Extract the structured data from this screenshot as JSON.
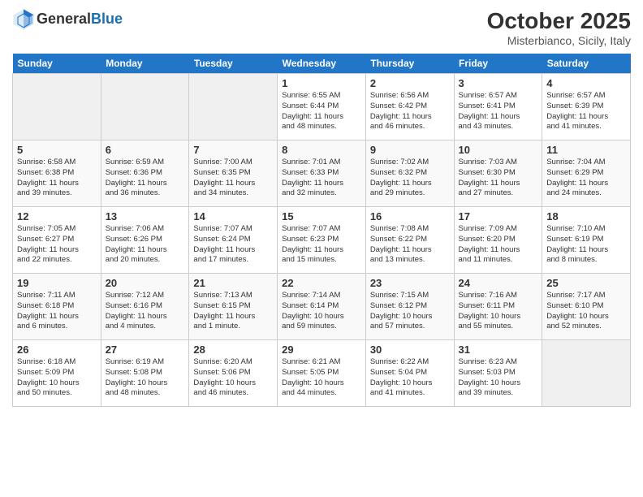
{
  "header": {
    "logo_general": "General",
    "logo_blue": "Blue",
    "month_title": "October 2025",
    "location": "Misterbianco, Sicily, Italy"
  },
  "weekdays": [
    "Sunday",
    "Monday",
    "Tuesday",
    "Wednesday",
    "Thursday",
    "Friday",
    "Saturday"
  ],
  "weeks": [
    [
      {
        "day": "",
        "info": ""
      },
      {
        "day": "",
        "info": ""
      },
      {
        "day": "",
        "info": ""
      },
      {
        "day": "1",
        "info": "Sunrise: 6:55 AM\nSunset: 6:44 PM\nDaylight: 11 hours\nand 48 minutes."
      },
      {
        "day": "2",
        "info": "Sunrise: 6:56 AM\nSunset: 6:42 PM\nDaylight: 11 hours\nand 46 minutes."
      },
      {
        "day": "3",
        "info": "Sunrise: 6:57 AM\nSunset: 6:41 PM\nDaylight: 11 hours\nand 43 minutes."
      },
      {
        "day": "4",
        "info": "Sunrise: 6:57 AM\nSunset: 6:39 PM\nDaylight: 11 hours\nand 41 minutes."
      }
    ],
    [
      {
        "day": "5",
        "info": "Sunrise: 6:58 AM\nSunset: 6:38 PM\nDaylight: 11 hours\nand 39 minutes."
      },
      {
        "day": "6",
        "info": "Sunrise: 6:59 AM\nSunset: 6:36 PM\nDaylight: 11 hours\nand 36 minutes."
      },
      {
        "day": "7",
        "info": "Sunrise: 7:00 AM\nSunset: 6:35 PM\nDaylight: 11 hours\nand 34 minutes."
      },
      {
        "day": "8",
        "info": "Sunrise: 7:01 AM\nSunset: 6:33 PM\nDaylight: 11 hours\nand 32 minutes."
      },
      {
        "day": "9",
        "info": "Sunrise: 7:02 AM\nSunset: 6:32 PM\nDaylight: 11 hours\nand 29 minutes."
      },
      {
        "day": "10",
        "info": "Sunrise: 7:03 AM\nSunset: 6:30 PM\nDaylight: 11 hours\nand 27 minutes."
      },
      {
        "day": "11",
        "info": "Sunrise: 7:04 AM\nSunset: 6:29 PM\nDaylight: 11 hours\nand 24 minutes."
      }
    ],
    [
      {
        "day": "12",
        "info": "Sunrise: 7:05 AM\nSunset: 6:27 PM\nDaylight: 11 hours\nand 22 minutes."
      },
      {
        "day": "13",
        "info": "Sunrise: 7:06 AM\nSunset: 6:26 PM\nDaylight: 11 hours\nand 20 minutes."
      },
      {
        "day": "14",
        "info": "Sunrise: 7:07 AM\nSunset: 6:24 PM\nDaylight: 11 hours\nand 17 minutes."
      },
      {
        "day": "15",
        "info": "Sunrise: 7:07 AM\nSunset: 6:23 PM\nDaylight: 11 hours\nand 15 minutes."
      },
      {
        "day": "16",
        "info": "Sunrise: 7:08 AM\nSunset: 6:22 PM\nDaylight: 11 hours\nand 13 minutes."
      },
      {
        "day": "17",
        "info": "Sunrise: 7:09 AM\nSunset: 6:20 PM\nDaylight: 11 hours\nand 11 minutes."
      },
      {
        "day": "18",
        "info": "Sunrise: 7:10 AM\nSunset: 6:19 PM\nDaylight: 11 hours\nand 8 minutes."
      }
    ],
    [
      {
        "day": "19",
        "info": "Sunrise: 7:11 AM\nSunset: 6:18 PM\nDaylight: 11 hours\nand 6 minutes."
      },
      {
        "day": "20",
        "info": "Sunrise: 7:12 AM\nSunset: 6:16 PM\nDaylight: 11 hours\nand 4 minutes."
      },
      {
        "day": "21",
        "info": "Sunrise: 7:13 AM\nSunset: 6:15 PM\nDaylight: 11 hours\nand 1 minute."
      },
      {
        "day": "22",
        "info": "Sunrise: 7:14 AM\nSunset: 6:14 PM\nDaylight: 10 hours\nand 59 minutes."
      },
      {
        "day": "23",
        "info": "Sunrise: 7:15 AM\nSunset: 6:12 PM\nDaylight: 10 hours\nand 57 minutes."
      },
      {
        "day": "24",
        "info": "Sunrise: 7:16 AM\nSunset: 6:11 PM\nDaylight: 10 hours\nand 55 minutes."
      },
      {
        "day": "25",
        "info": "Sunrise: 7:17 AM\nSunset: 6:10 PM\nDaylight: 10 hours\nand 52 minutes."
      }
    ],
    [
      {
        "day": "26",
        "info": "Sunrise: 6:18 AM\nSunset: 5:09 PM\nDaylight: 10 hours\nand 50 minutes."
      },
      {
        "day": "27",
        "info": "Sunrise: 6:19 AM\nSunset: 5:08 PM\nDaylight: 10 hours\nand 48 minutes."
      },
      {
        "day": "28",
        "info": "Sunrise: 6:20 AM\nSunset: 5:06 PM\nDaylight: 10 hours\nand 46 minutes."
      },
      {
        "day": "29",
        "info": "Sunrise: 6:21 AM\nSunset: 5:05 PM\nDaylight: 10 hours\nand 44 minutes."
      },
      {
        "day": "30",
        "info": "Sunrise: 6:22 AM\nSunset: 5:04 PM\nDaylight: 10 hours\nand 41 minutes."
      },
      {
        "day": "31",
        "info": "Sunrise: 6:23 AM\nSunset: 5:03 PM\nDaylight: 10 hours\nand 39 minutes."
      },
      {
        "day": "",
        "info": ""
      }
    ]
  ]
}
